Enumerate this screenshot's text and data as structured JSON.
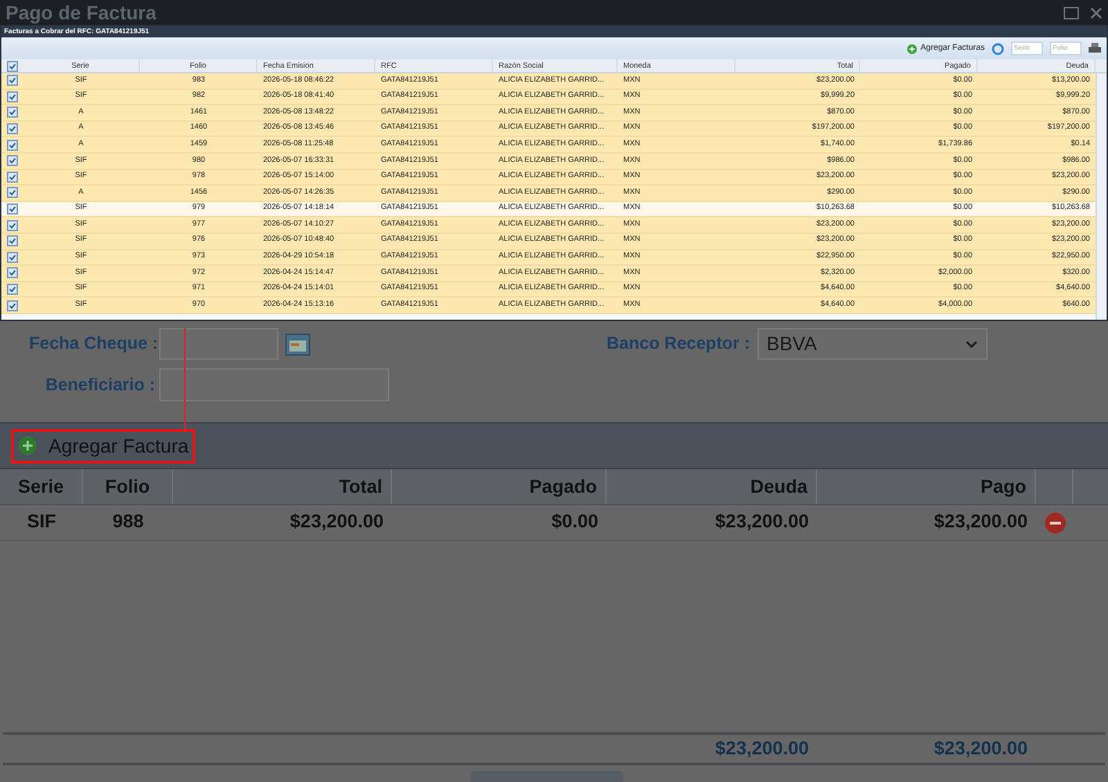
{
  "window": {
    "title": "Pago de Factura"
  },
  "popup": {
    "title": "Facturas a Cobrar del RFC: GATA841219J51",
    "add_button": "Agregar Facturas",
    "serie_placeholder": "Serie",
    "folio_placeholder": "Folio",
    "all_checked": true,
    "columns": [
      "Serie",
      "Folio",
      "Fecha Emision",
      "RFC",
      "Razón Social",
      "Moneda",
      "Total",
      "Pagado",
      "Deuda"
    ],
    "rows": [
      {
        "checked": true,
        "selected": false,
        "cells": [
          "SIF",
          "983",
          "2026-05-18 08:46:22",
          "GATA841219J51",
          "ALICIA ELIZABETH GARRID...",
          "MXN",
          "$23,200.00",
          "$0.00",
          "$13,200.00"
        ]
      },
      {
        "checked": true,
        "selected": false,
        "cells": [
          "SIF",
          "982",
          "2026-05-18 08:41:40",
          "GATA841219J51",
          "ALICIA ELIZABETH GARRID...",
          "MXN",
          "$9,999.20",
          "$0.00",
          "$9,999.20"
        ]
      },
      {
        "checked": true,
        "selected": false,
        "cells": [
          "A",
          "1461",
          "2026-05-08 13:48:22",
          "GATA841219J51",
          "ALICIA ELIZABETH GARRID...",
          "MXN",
          "$870.00",
          "$0.00",
          "$870.00"
        ]
      },
      {
        "checked": true,
        "selected": false,
        "cells": [
          "A",
          "1460",
          "2026-05-08 13:45:46",
          "GATA841219J51",
          "ALICIA ELIZABETH GARRID...",
          "MXN",
          "$197,200.00",
          "$0.00",
          "$197,200.00"
        ]
      },
      {
        "checked": true,
        "selected": false,
        "cells": [
          "A",
          "1459",
          "2026-05-08 11:25:48",
          "GATA841219J51",
          "ALICIA ELIZABETH GARRID...",
          "MXN",
          "$1,740.00",
          "$1,739.86",
          "$0.14"
        ]
      },
      {
        "checked": true,
        "selected": false,
        "cells": [
          "SIF",
          "980",
          "2026-05-07 16:33:31",
          "GATA841219J51",
          "ALICIA ELIZABETH GARRID...",
          "MXN",
          "$986.00",
          "$0.00",
          "$986.00"
        ]
      },
      {
        "checked": true,
        "selected": false,
        "cells": [
          "SIF",
          "978",
          "2026-05-07 15:14:00",
          "GATA841219J51",
          "ALICIA ELIZABETH GARRID...",
          "MXN",
          "$23,200.00",
          "$0.00",
          "$23,200.00"
        ]
      },
      {
        "checked": true,
        "selected": false,
        "cells": [
          "A",
          "1456",
          "2026-05-07 14:26:35",
          "GATA841219J51",
          "ALICIA ELIZABETH GARRID...",
          "MXN",
          "$290.00",
          "$0.00",
          "$290.00"
        ]
      },
      {
        "checked": true,
        "selected": true,
        "cells": [
          "SIF",
          "979",
          "2026-05-07 14:18:14",
          "GATA841219J51",
          "ALICIA ELIZABETH GARRID...",
          "MXN",
          "$10,263.68",
          "$0.00",
          "$10,263.68"
        ]
      },
      {
        "checked": true,
        "selected": false,
        "cells": [
          "SIF",
          "977",
          "2026-05-07 14:10:27",
          "GATA841219J51",
          "ALICIA ELIZABETH GARRID...",
          "MXN",
          "$23,200.00",
          "$0.00",
          "$23,200.00"
        ]
      },
      {
        "checked": true,
        "selected": false,
        "cells": [
          "SIF",
          "976",
          "2026-05-07 10:48:40",
          "GATA841219J51",
          "ALICIA ELIZABETH GARRID...",
          "MXN",
          "$23,200.00",
          "$0.00",
          "$23,200.00"
        ]
      },
      {
        "checked": true,
        "selected": false,
        "cells": [
          "SIF",
          "973",
          "2026-04-29 10:54:18",
          "GATA841219J51",
          "ALICIA ELIZABETH GARRID...",
          "MXN",
          "$22,950.00",
          "$0.00",
          "$22,950.00"
        ]
      },
      {
        "checked": true,
        "selected": false,
        "cells": [
          "SIF",
          "972",
          "2026-04-24 15:14:47",
          "GATA841219J51",
          "ALICIA ELIZABETH GARRID...",
          "MXN",
          "$2,320.00",
          "$2,000.00",
          "$320.00"
        ]
      },
      {
        "checked": true,
        "selected": false,
        "cells": [
          "SIF",
          "971",
          "2026-04-24 15:14:01",
          "GATA841219J51",
          "ALICIA ELIZABETH GARRID...",
          "MXN",
          "$4,640.00",
          "$0.00",
          "$4,640.00"
        ]
      },
      {
        "checked": true,
        "selected": false,
        "cells": [
          "SIF",
          "970",
          "2026-04-24 15:13:16",
          "GATA841219J51",
          "ALICIA ELIZABETH GARRID...",
          "MXN",
          "$4,640.00",
          "$4,000.00",
          "$640.00"
        ]
      }
    ]
  },
  "form": {
    "fecha_cheque_label": "Fecha Cheque :",
    "banco_label": "Banco Receptor :",
    "banco_value": "BBVA",
    "beneficiario_label": "Beneficiario :"
  },
  "payments": {
    "add_button": "Agregar Factura",
    "columns": [
      "Serie",
      "Folio",
      "Total",
      "Pagado",
      "Deuda",
      "Pago"
    ],
    "rows": [
      {
        "cells": [
          "SIF",
          "988",
          "$23,200.00",
          "$0.00",
          "$23,200.00",
          "$23,200.00"
        ]
      }
    ],
    "totals": {
      "deuda": "$23,200.00",
      "pago": "$23,200.00"
    }
  }
}
